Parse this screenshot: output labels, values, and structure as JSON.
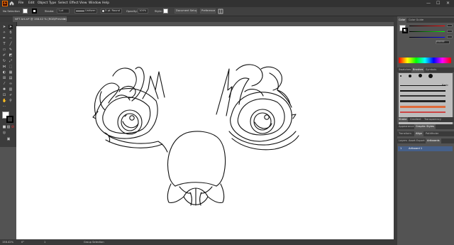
{
  "menubar": {
    "app_logo": "Ai",
    "items": [
      "File",
      "Edit",
      "Object",
      "Type",
      "Select",
      "Effect",
      "View",
      "Window",
      "Help"
    ],
    "window_controls": [
      "—",
      "☐",
      "✕"
    ]
  },
  "controlbar": {
    "selection_label": "No Selection",
    "stroke_label": "Stroke:",
    "stroke_value": "1 pt",
    "profile_value": "Uniform",
    "brush_value": "5 pt. Round",
    "opacity_label": "Opacity:",
    "opacity_value": "100%",
    "style_label": "Style:",
    "document_setup": "Document Setup",
    "preferences": "Preferences"
  },
  "document": {
    "tab_title": "NFT Art.ai* @ 158.42 % (RGB/Preview)",
    "close": "✕"
  },
  "statusbar": {
    "zoom": "158.42%",
    "angle": "0°",
    "artboard_nav": "1",
    "tool_info": "Group Selection"
  },
  "panels": {
    "color_tabs": [
      "Color",
      "Color Guide"
    ],
    "color_hex": "FFFFFF",
    "brush_tabs": [
      "Swatches",
      "Brushes",
      "Symbols"
    ],
    "brush_name": "Basic",
    "stroke_tabs": [
      "Stroke",
      "Gradient",
      "Transparency"
    ],
    "appearance_tabs": [
      "Appearance",
      "Graphic Styles"
    ],
    "transform_tabs": [
      "Transform",
      "Align",
      "Pathfinder"
    ],
    "layers_tabs": [
      "Layers",
      "Asset Export",
      "Artboards"
    ],
    "artboard_item": "Artboard 1",
    "artboard_number": "1"
  },
  "colors": {
    "accent": "#ff7c00",
    "ui_dark": "#323232",
    "ui_mid": "#535353",
    "selection_blue": "#46608a",
    "canvas": "#ffffff"
  }
}
